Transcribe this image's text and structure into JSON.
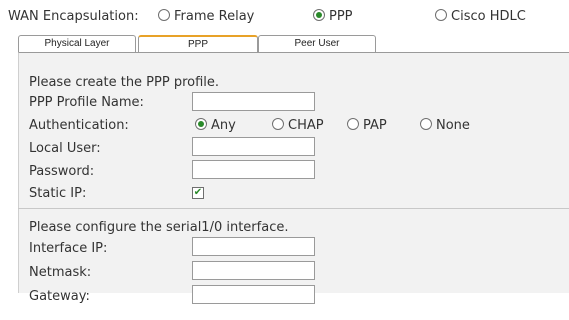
{
  "wan": {
    "label": "WAN Encapsulation:",
    "options": [
      {
        "label": "Frame Relay",
        "selected": false
      },
      {
        "label": "PPP",
        "selected": true
      },
      {
        "label": "Cisco HDLC",
        "selected": false
      }
    ]
  },
  "tabs": [
    {
      "label": "Physical Layer",
      "active": false
    },
    {
      "label": "PPP",
      "active": true
    },
    {
      "label": "Peer User",
      "active": false
    }
  ],
  "ppp_section": {
    "heading": "Please create the PPP profile.",
    "profile_name_label": "PPP Profile Name:",
    "profile_name_value": "",
    "auth_label": "Authentication:",
    "auth_options": [
      {
        "label": "Any",
        "selected": true
      },
      {
        "label": "CHAP",
        "selected": false
      },
      {
        "label": "PAP",
        "selected": false
      },
      {
        "label": "None",
        "selected": false
      }
    ],
    "local_user_label": "Local User:",
    "local_user_value": "",
    "password_label": "Password:",
    "password_value": "",
    "static_ip_label": "Static IP:",
    "static_ip_checked": true
  },
  "serial_section": {
    "heading": "Please configure the serial1/0 interface.",
    "interface_ip_label": "Interface IP:",
    "interface_ip_value": "",
    "netmask_label": "Netmask:",
    "netmask_value": "",
    "gateway_label": "Gateway:",
    "gateway_value": ""
  },
  "colors": {
    "active_tab_accent": "#e8a228",
    "radio_dot": "#2a8a2a",
    "panel_bg": "#f2f2f2"
  }
}
